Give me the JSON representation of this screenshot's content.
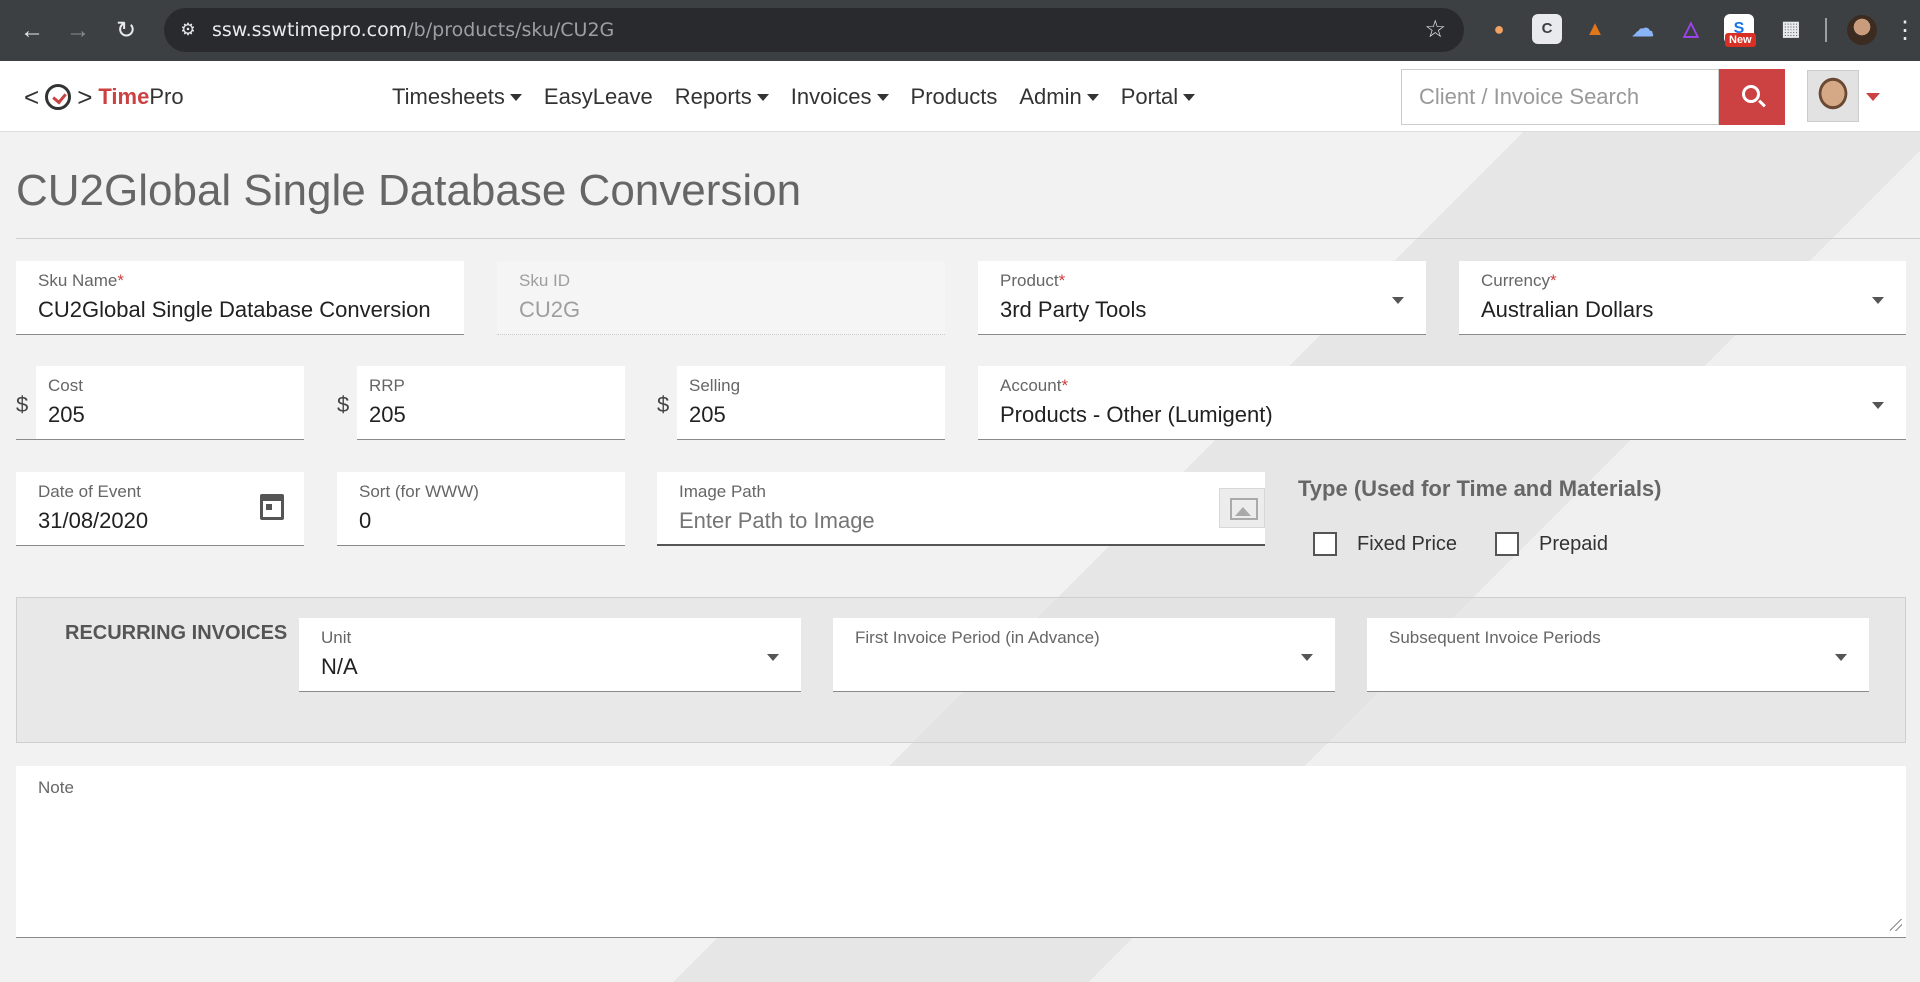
{
  "browser": {
    "url_host": "ssw.sswtimepro.com",
    "url_path": "/b/products/sku/CU2G",
    "new_badge": "New"
  },
  "header": {
    "logo": {
      "left": "<",
      "right": ">",
      "time": "Time",
      "pro": "Pro"
    },
    "nav": [
      {
        "label": "Timesheets",
        "dropdown": true
      },
      {
        "label": "EasyLeave",
        "dropdown": false
      },
      {
        "label": "Reports",
        "dropdown": true
      },
      {
        "label": "Invoices",
        "dropdown": true
      },
      {
        "label": "Products",
        "dropdown": false
      },
      {
        "label": "Admin",
        "dropdown": true
      },
      {
        "label": "Portal",
        "dropdown": true
      }
    ],
    "search_placeholder": "Client / Invoice Search",
    "accent_color": "#cc4141"
  },
  "page": {
    "title": "CU2Global Single Database Conversion"
  },
  "form": {
    "sku_name": {
      "label": "Sku Name",
      "required": "*",
      "value": "CU2Global Single Database Conversion"
    },
    "sku_id": {
      "label": "Sku ID",
      "value": "CU2G"
    },
    "product": {
      "label": "Product",
      "required": "*",
      "value": "3rd Party Tools"
    },
    "currency": {
      "label": "Currency",
      "required": "*",
      "value": "Australian Dollars"
    },
    "cost": {
      "label": "Cost",
      "prefix": "$",
      "value": "205"
    },
    "rrp": {
      "label": "RRP",
      "prefix": "$",
      "value": "205"
    },
    "selling": {
      "label": "Selling",
      "prefix": "$",
      "value": "205"
    },
    "account": {
      "label": "Account",
      "required": "*",
      "value": "Products - Other (Lumigent)"
    },
    "date_of_event": {
      "label": "Date of Event",
      "value": "31/08/2020"
    },
    "sort": {
      "label": "Sort (for WWW)",
      "value": "0"
    },
    "image_path": {
      "label": "Image Path",
      "placeholder": "Enter Path to Image"
    },
    "type_heading": "Type (Used for Time and Materials)",
    "fixed_price": {
      "label": "Fixed Price",
      "checked": false
    },
    "prepaid": {
      "label": "Prepaid",
      "checked": false
    }
  },
  "recurring": {
    "title": "RECURRING INVOICES",
    "unit": {
      "label": "Unit",
      "value": "N/A"
    },
    "first_period": {
      "label": "First Invoice Period (in Advance)",
      "value": ""
    },
    "subsequent_periods": {
      "label": "Subsequent Invoice Periods",
      "value": ""
    }
  },
  "note": {
    "label": "Note",
    "value": ""
  }
}
